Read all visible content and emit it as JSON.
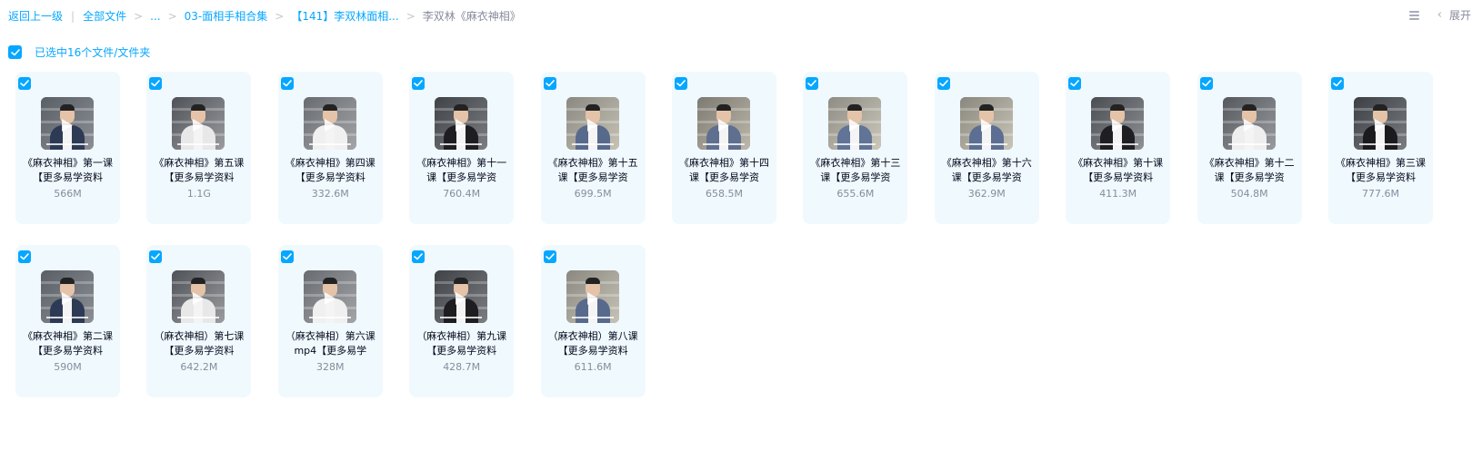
{
  "breadcrumb": {
    "back": "返回上一级",
    "all_files": "全部文件",
    "ellipsis": "...",
    "folder1": "03-面相手相合集",
    "folder2": "【141】李双林面相...",
    "current": "李双林《麻衣神相》"
  },
  "toolbar": {
    "list_icon": "list-view-icon",
    "expand_label": "展开",
    "chevron": "‹"
  },
  "selection": {
    "text": "已选中16个文件/文件夹",
    "checked": true
  },
  "colors": {
    "accent": "#06a7ff",
    "card_bg": "#f0f9fe",
    "muted": "#878c9c"
  },
  "files": [
    {
      "name": "《麻衣神相》第一课【更多易学资料",
      "size": "566M",
      "checked": true,
      "icon": "video-thumbnail-icon"
    },
    {
      "name": "《麻衣神相》第五课【更多易学资料",
      "size": "1.1G",
      "checked": true,
      "icon": "video-thumbnail-icon"
    },
    {
      "name": "《麻衣神相》第四课【更多易学资料",
      "size": "332.6M",
      "checked": true,
      "icon": "video-thumbnail-icon"
    },
    {
      "name": "《麻衣神相》第十一课【更多易学资",
      "size": "760.4M",
      "checked": true,
      "icon": "video-thumbnail-icon"
    },
    {
      "name": "《麻衣神相》第十五课【更多易学资",
      "size": "699.5M",
      "checked": true,
      "icon": "video-thumbnail-icon"
    },
    {
      "name": "《麻衣神相》第十四课【更多易学资",
      "size": "658.5M",
      "checked": true,
      "icon": "video-thumbnail-icon"
    },
    {
      "name": "《麻衣神相》第十三课【更多易学资",
      "size": "655.6M",
      "checked": true,
      "icon": "video-thumbnail-icon"
    },
    {
      "name": "《麻衣神相》第十六课【更多易学资",
      "size": "362.9M",
      "checked": true,
      "icon": "video-thumbnail-icon"
    },
    {
      "name": "《麻衣神相》第十课【更多易学资料",
      "size": "411.3M",
      "checked": true,
      "icon": "video-thumbnail-icon"
    },
    {
      "name": "《麻衣神相》第十二课【更多易学资",
      "size": "504.8M",
      "checked": true,
      "icon": "video-thumbnail-icon"
    },
    {
      "name": "《麻衣神相》第三课【更多易学资料",
      "size": "777.6M",
      "checked": true,
      "icon": "video-thumbnail-icon"
    },
    {
      "name": "《麻衣神相》第二课【更多易学资料",
      "size": "590M",
      "checked": true,
      "icon": "video-thumbnail-icon"
    },
    {
      "name": "（麻衣神相）第七课【更多易学资料",
      "size": "642.2M",
      "checked": true,
      "icon": "video-thumbnail-icon"
    },
    {
      "name": "（麻衣神相）第六课mp4【更多易学",
      "size": "328M",
      "checked": true,
      "icon": "video-thumbnail-icon"
    },
    {
      "name": "（麻衣神相）第九课【更多易学资料",
      "size": "428.7M",
      "checked": true,
      "icon": "video-thumbnail-icon"
    },
    {
      "name": "（麻衣神相）第八课【更多易学资料",
      "size": "611.6M",
      "checked": true,
      "icon": "video-thumbnail-icon"
    }
  ]
}
